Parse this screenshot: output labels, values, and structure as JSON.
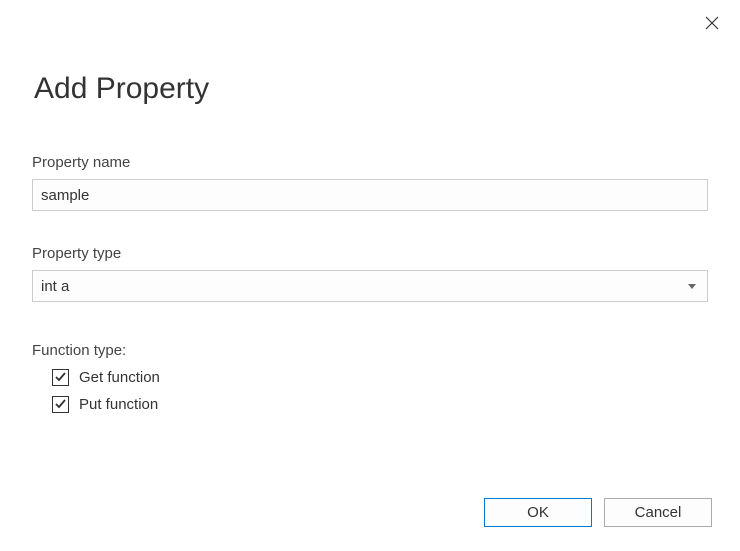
{
  "dialog": {
    "title": "Add Property"
  },
  "fields": {
    "propertyNameLabel": "Property name",
    "propertyNameValue": "sample",
    "propertyTypeLabel": "Property type",
    "propertyTypeValue": "int a"
  },
  "functionType": {
    "label": "Function type:",
    "getLabel": "Get function",
    "putLabel": "Put function"
  },
  "buttons": {
    "ok": "OK",
    "cancel": "Cancel"
  }
}
